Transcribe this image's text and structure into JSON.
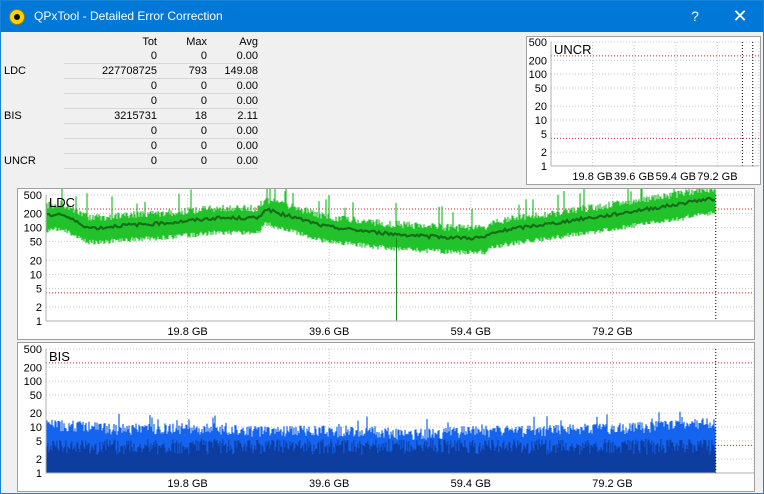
{
  "window": {
    "title": "QPxTool - Detailed Error Correction",
    "help_label": "?",
    "close_label": "✕",
    "icon": "qpxtool-app-icon"
  },
  "stats": {
    "headers": [
      "",
      "Tot",
      "Max",
      "Avg"
    ],
    "rows": [
      [
        "",
        "0",
        "0",
        "0.00"
      ],
      [
        "LDC",
        "227708725",
        "793",
        "149.08"
      ],
      [
        "",
        "0",
        "0",
        "0.00"
      ],
      [
        "",
        "0",
        "0",
        "0.00"
      ],
      [
        "BIS",
        "3215731",
        "18",
        "2.11"
      ],
      [
        "",
        "0",
        "0",
        "0.00"
      ],
      [
        "",
        "0",
        "0",
        "0.00"
      ],
      [
        "UNCR",
        "0",
        "0",
        "0.00"
      ]
    ]
  },
  "colors": {
    "titlebar": "#0078d7",
    "ldc": "#22c22a",
    "ldc_avg": "#176d1b",
    "bis": "#1464f0",
    "bis_dark": "#0c2e80",
    "threshold": "#d02020"
  },
  "chart_data": [
    {
      "type": "area",
      "title": "UNCR",
      "x_ticks": [
        "19.8 GB",
        "39.6 GB",
        "59.4 GB",
        "79.2 GB"
      ],
      "y_ticks": [
        "500",
        "200",
        "100",
        "50",
        "20",
        "10",
        "5",
        "2",
        "1"
      ],
      "y_scale": "log",
      "ylim": [
        1,
        500
      ],
      "grid": true,
      "series": [
        {
          "values": []
        }
      ]
    },
    {
      "type": "area",
      "title": "LDC",
      "x_ticks": [
        "19.8 GB",
        "39.6 GB",
        "59.4 GB",
        "79.2 GB"
      ],
      "y_ticks": [
        "500",
        "200",
        "100",
        "50",
        "20",
        "10",
        "5",
        "2",
        "1"
      ],
      "y_scale": "log",
      "ylim": [
        1,
        500
      ],
      "xlim_gb": [
        0,
        100
      ],
      "grid": true,
      "end_gb": 94.6,
      "series": [
        {
          "x": [
            0,
            2,
            4,
            6,
            8,
            10,
            12,
            15,
            18,
            21,
            24,
            27,
            30,
            31,
            33,
            36,
            39,
            42,
            45,
            48,
            51,
            54,
            57,
            60,
            62,
            63,
            66,
            69,
            72,
            75,
            78,
            81,
            84,
            87,
            90,
            92,
            94.6
          ],
          "values": [
            180,
            200,
            140,
            100,
            100,
            110,
            115,
            120,
            130,
            145,
            160,
            160,
            160,
            250,
            200,
            150,
            110,
            95,
            85,
            75,
            70,
            65,
            62,
            60,
            62,
            75,
            95,
            110,
            125,
            150,
            170,
            200,
            240,
            280,
            330,
            380,
            420
          ]
        }
      ]
    },
    {
      "type": "area",
      "title": "BIS",
      "x_ticks": [
        "19.8 GB",
        "39.6 GB",
        "59.4 GB",
        "79.2 GB"
      ],
      "y_ticks": [
        "500",
        "200",
        "100",
        "50",
        "20",
        "10",
        "5",
        "2",
        "1"
      ],
      "y_scale": "log",
      "ylim": [
        1,
        500
      ],
      "xlim_gb": [
        0,
        100
      ],
      "grid": true,
      "end_gb": 94.6,
      "series": [
        {
          "x": [
            0,
            5,
            10,
            15,
            20,
            25,
            30,
            35,
            40,
            45,
            50,
            55,
            60,
            65,
            70,
            75,
            80,
            85,
            90,
            94.6
          ],
          "values": [
            11,
            10,
            9,
            9,
            9,
            9,
            8,
            8,
            8,
            8,
            7,
            7,
            8,
            8,
            8,
            9,
            9,
            10,
            11,
            12
          ]
        }
      ]
    }
  ]
}
